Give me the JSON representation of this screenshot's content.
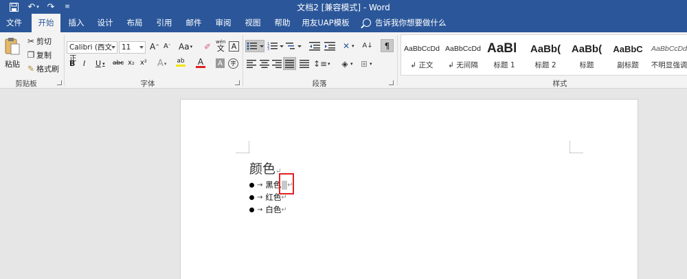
{
  "title_bar": {
    "title": "文档2 [兼容模式] - Word",
    "icons": [
      "save-icon",
      "undo-icon",
      "redo-icon",
      "customize-quick-access-icon"
    ]
  },
  "tabs": [
    "文件",
    "开始",
    "插入",
    "设计",
    "布局",
    "引用",
    "邮件",
    "审阅",
    "视图",
    "帮助",
    "用友UAP模板"
  ],
  "active_tab": "开始",
  "tell_me": "告诉我你想要做什么",
  "clipboard": {
    "paste": "粘贴",
    "cut": "剪切",
    "copy": "复制",
    "format_painter": "格式刷",
    "label": "剪贴板"
  },
  "font": {
    "font_name": "Calibri (西文正",
    "font_size": "11",
    "grow": "A",
    "shrink": "A",
    "case": "Aa",
    "phonetic": "wén",
    "border_char": "A",
    "bold": "B",
    "italic": "I",
    "underline": "U",
    "strike": "abc",
    "subscript": "x₂",
    "superscript": "x²",
    "effects": "A",
    "highlight": "ab",
    "font_color": "A",
    "shading": "A",
    "enclose": "字",
    "label": "字体"
  },
  "paragraph": {
    "label": "段落"
  },
  "styles": {
    "label": "样式",
    "items": [
      {
        "sample": "AaBbCcDd",
        "name": "↲ 正文"
      },
      {
        "sample": "AaBbCcDd",
        "name": "↲ 无间隔"
      },
      {
        "sample": "AaBl",
        "name": "标题 1"
      },
      {
        "sample": "AaBb(",
        "name": "标题 2"
      },
      {
        "sample": "AaBb(",
        "name": "标题"
      },
      {
        "sample": "AaBbC",
        "name": "副标题"
      },
      {
        "sample": "AaBbCcDd",
        "name": "不明显强调"
      }
    ]
  },
  "document": {
    "heading": "颜色",
    "items": [
      "黑色",
      "红色",
      "白色"
    ],
    "para_mark": "↵",
    "tab_mark": "→"
  },
  "colors": {
    "accent": "#2b579a",
    "highlight_bar": "#f5e400",
    "font_color_bar": "#e02020",
    "callout": "#e02020"
  }
}
